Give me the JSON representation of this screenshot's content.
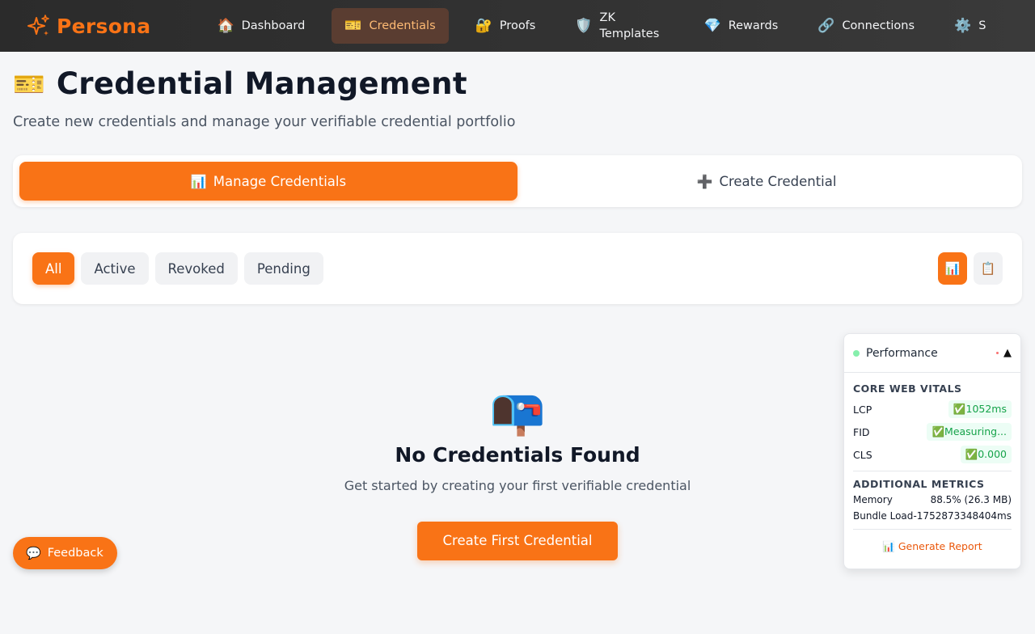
{
  "brand": {
    "name": "Persona",
    "icon": "sparkle-icon"
  },
  "nav": {
    "items": [
      {
        "icon": "🏠",
        "label": "Dashboard"
      },
      {
        "icon": "🎫",
        "label": "Credentials"
      },
      {
        "icon": "🔐",
        "label": "Proofs"
      },
      {
        "icon": "🛡️",
        "label": "ZK Templates"
      },
      {
        "icon": "💎",
        "label": "Rewards"
      },
      {
        "icon": "🔗",
        "label": "Connections"
      },
      {
        "icon": "⚙️",
        "label": "S"
      }
    ],
    "active_index": 1
  },
  "header": {
    "icon": "🎫",
    "title": "Credential Management",
    "subtitle": "Create new credentials and manage your verifiable credential portfolio"
  },
  "tabs": [
    {
      "icon": "📊",
      "label": "Manage Credentials"
    },
    {
      "icon": "➕",
      "label": "Create Credential"
    }
  ],
  "filters": {
    "chips": [
      "All",
      "Active",
      "Revoked",
      "Pending"
    ],
    "active": "All",
    "view_toggles": [
      {
        "icon": "📊",
        "name": "chart-view"
      },
      {
        "icon": "📋",
        "name": "list-view"
      }
    ]
  },
  "empty_state": {
    "icon": "📭",
    "title": "No Credentials Found",
    "message": "Get started by creating your first verifiable credential",
    "button": "Create First Credential"
  },
  "feedback": {
    "icon": "💬",
    "label": "Feedback"
  },
  "performance": {
    "title": "Performance",
    "toggle": "▲",
    "vitals_heading": "CORE WEB VITALS",
    "vitals": [
      {
        "label": "LCP",
        "value": "✅1052ms"
      },
      {
        "label": "FID",
        "value": "✅Measuring..."
      },
      {
        "label": "CLS",
        "value": "✅0.000"
      }
    ],
    "additional_heading": "ADDITIONAL METRICS",
    "metrics": [
      {
        "label": "Memory",
        "value": "88.5% (26.3 MB)"
      },
      {
        "label": "Bundle Load",
        "value": "-1752873348404ms"
      }
    ],
    "report_label": "📊 Generate Report"
  },
  "colors": {
    "accent": "#f97316",
    "nav_bg": "#2b2b2b",
    "active_nav_bg": "#5a3d31",
    "vital_ok": "#16a34a"
  }
}
